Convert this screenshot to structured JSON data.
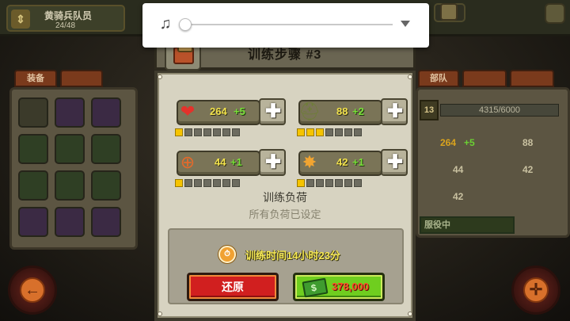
{
  "background": {
    "player_name": "黄骑兵队员",
    "player_level": "24/48",
    "currency_1": "",
    "left_tabs": [
      "装备",
      ""
    ],
    "right_tabs": [
      "部队",
      "",
      ""
    ],
    "xp": "4315/6000",
    "level": "13",
    "stats": [
      {
        "value": "264",
        "bonus": "+5",
        "color": "#d9a31e"
      },
      {
        "value": "88",
        "bonus": "",
        "color": "#c9c1a0"
      },
      {
        "value": "44",
        "bonus": "",
        "color": "#c9c1a0"
      },
      {
        "value": "42",
        "bonus": "",
        "color": "#c9c1a0"
      },
      {
        "value": "42",
        "bonus": "",
        "color": "#c9c1a0"
      }
    ],
    "status": "服役中",
    "back_icon": "arrow-left-icon",
    "target_icon": "crosshair-icon"
  },
  "music": {
    "icon": "music-note-icon",
    "progress": 0.0,
    "dropdown_icon": "chevron-down-icon"
  },
  "dialog": {
    "header_icon": "supply-crate-icon",
    "title": "训练步骤 #3",
    "stats": [
      {
        "name": "health",
        "icon": "heart-icon",
        "value": "264",
        "bonus": "+5",
        "pips_total": 7,
        "pips_on": 1
      },
      {
        "name": "armor",
        "icon": "helmet-icon",
        "value": "88",
        "bonus": "+2",
        "pips_total": 7,
        "pips_on": 3
      },
      {
        "name": "aim",
        "icon": "target-icon",
        "value": "44",
        "bonus": "+1",
        "pips_total": 7,
        "pips_on": 1
      },
      {
        "name": "damage",
        "icon": "explosion-icon",
        "value": "42",
        "bonus": "+1",
        "pips_total": 7,
        "pips_on": 1
      }
    ],
    "load_title": "训练负荷",
    "load_subtitle": "所有负荷已设定",
    "timer_icon": "stopwatch-icon",
    "timer_text": "训练时间14小时23分",
    "reset_label": "还原",
    "buy_icon": "cash-icon",
    "buy_amount": "378,000",
    "colors": {
      "value_yellow": "#f3e34c",
      "bonus_green": "#7be13a",
      "reset_red": "#d11f1f",
      "buy_green": "#6fce1f",
      "price_red": "#ff4a2a"
    }
  }
}
